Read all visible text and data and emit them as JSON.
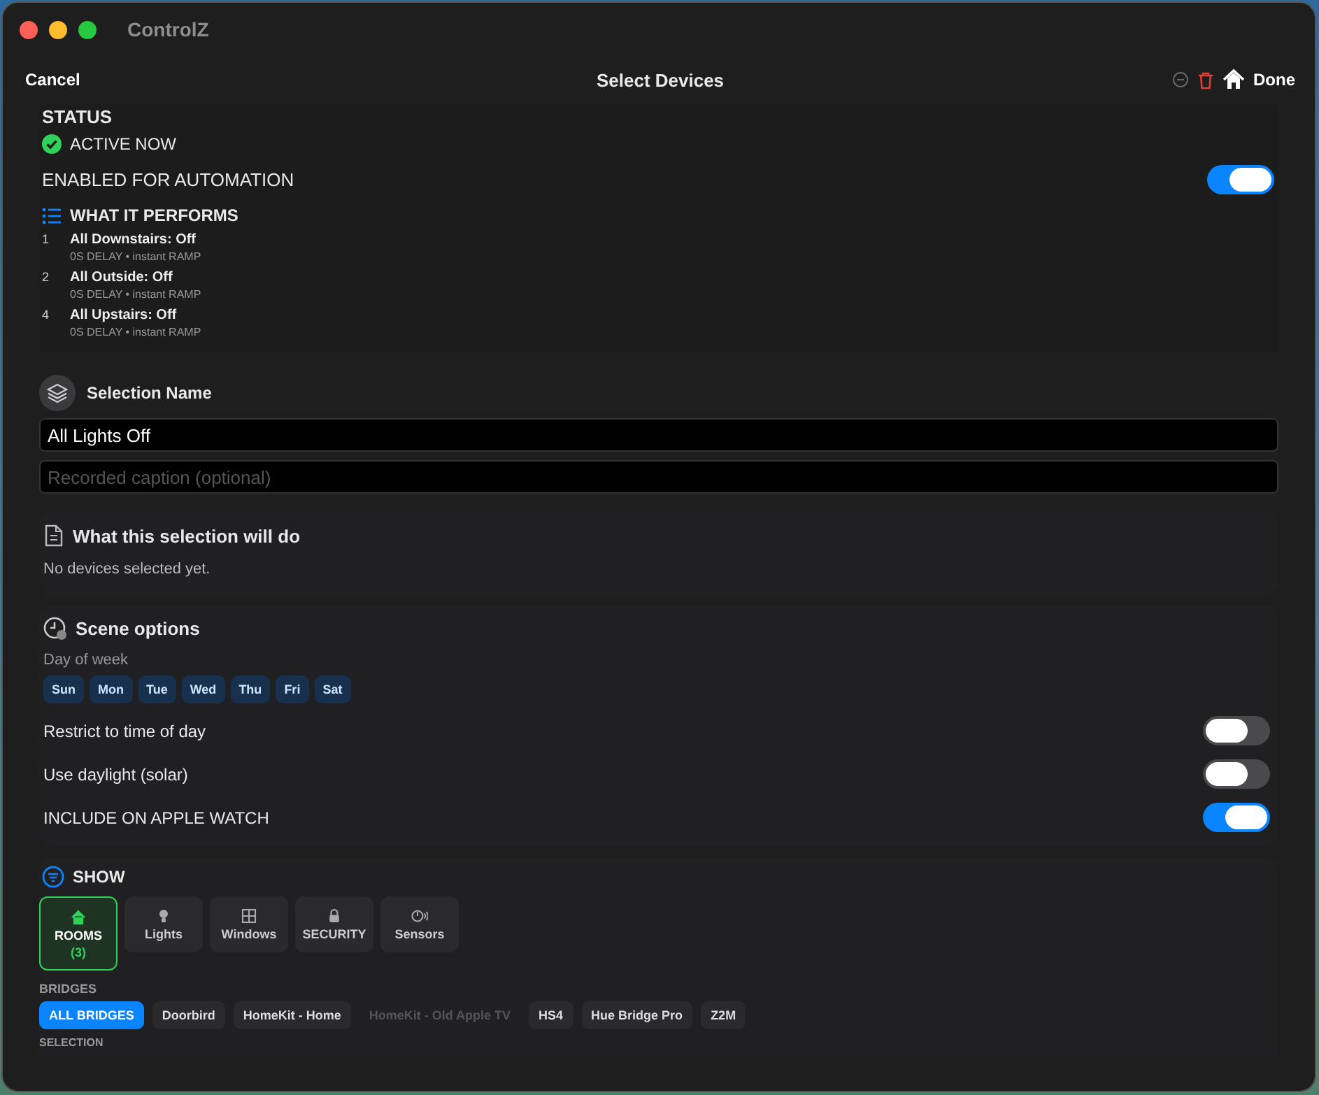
{
  "window": {
    "title": "ControlZ"
  },
  "nav": {
    "cancel": "Cancel",
    "title": "Select Devices",
    "done": "Done"
  },
  "status": {
    "heading": "STATUS",
    "state": "ACTIVE NOW",
    "automation_label": "ENABLED FOR AUTOMATION",
    "automation_on": true,
    "performs_heading": "WHAT IT PERFORMS",
    "steps": [
      {
        "number": "1",
        "name": "All Downstairs: Off",
        "detail": "0S DELAY • instant RAMP"
      },
      {
        "number": "2",
        "name": "All Outside: Off",
        "detail": "0S DELAY • instant RAMP"
      },
      {
        "number": "4",
        "name": "All Upstairs: Off",
        "detail": "0S DELAY • instant RAMP"
      }
    ]
  },
  "selection_name": {
    "heading": "Selection Name",
    "value": "All Lights Off",
    "caption_placeholder": "Recorded caption (optional)"
  },
  "summary": {
    "heading": "What this selection will do",
    "text": "No devices selected yet."
  },
  "scene_options": {
    "heading": "Scene options",
    "day_label": "Day of week",
    "days": [
      {
        "label": "Sun",
        "selected": true
      },
      {
        "label": "Mon",
        "selected": true
      },
      {
        "label": "Tue",
        "selected": true
      },
      {
        "label": "Wed",
        "selected": true
      },
      {
        "label": "Thu",
        "selected": true
      },
      {
        "label": "Fri",
        "selected": true
      },
      {
        "label": "Sat",
        "selected": true
      }
    ],
    "toggles": [
      {
        "label": "Restrict to time of day",
        "on": false
      },
      {
        "label": "Use daylight (solar)",
        "on": false
      },
      {
        "label": "INCLUDE ON APPLE WATCH",
        "on": true
      }
    ]
  },
  "show": {
    "heading": "SHOW",
    "filters": [
      {
        "kind": "house",
        "label": "ROOMS",
        "count": "(3)",
        "selected": true
      },
      {
        "kind": "bulb",
        "label": "Lights",
        "selected": false
      },
      {
        "kind": "window",
        "label": "Windows",
        "selected": false
      },
      {
        "kind": "lock",
        "label": "SECURITY",
        "selected": false
      },
      {
        "kind": "sensor",
        "label": "Sensors",
        "selected": false
      }
    ],
    "bridges_label": "BRIDGES",
    "bridges": [
      {
        "label": "ALL BRIDGES",
        "selected": true,
        "disabled": false
      },
      {
        "label": "Doorbird",
        "selected": false,
        "disabled": false
      },
      {
        "label": "HomeKit - Home",
        "selected": false,
        "disabled": false
      },
      {
        "label": "HomeKit - Old Apple TV",
        "selected": false,
        "disabled": true
      },
      {
        "label": "HS4",
        "selected": false,
        "disabled": false
      },
      {
        "label": "Hue Bridge Pro",
        "selected": false,
        "disabled": false
      },
      {
        "label": "Z2M",
        "selected": false,
        "disabled": false
      }
    ],
    "selection_label": "SELECTION"
  }
}
